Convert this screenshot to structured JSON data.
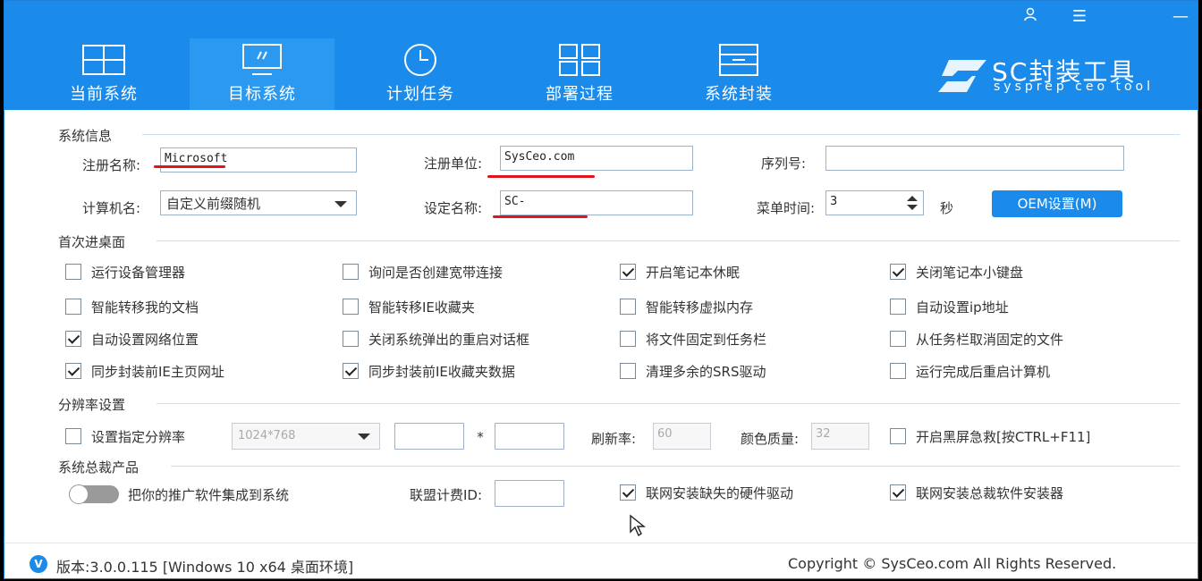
{
  "window": {
    "controls": {
      "user": "user-icon",
      "menu": "☰",
      "close": "—"
    }
  },
  "tabs": [
    {
      "label": "当前系统",
      "icon": "windows-icon"
    },
    {
      "label": "目标系统",
      "icon": "monitor-icon",
      "active": true
    },
    {
      "label": "计划任务",
      "icon": "clock-icon"
    },
    {
      "label": "部署过程",
      "icon": "grid-icon"
    },
    {
      "label": "系统封装",
      "icon": "package-icon"
    }
  ],
  "logo": {
    "title": "SC封装工具",
    "subtitle": "sysprep ceo tool"
  },
  "sys_info": {
    "section": "系统信息",
    "reg_name_label": "注册名称:",
    "reg_name_value": "Microsoft",
    "reg_org_label": "注册单位:",
    "reg_org_value": "SysCeo.com",
    "serial_label": "序列号:",
    "serial_value": "",
    "computer_label": "计算机名:",
    "computer_value": "自定义前缀随机",
    "setname_label": "设定名称:",
    "setname_value": "SC-",
    "menu_time_label": "菜单时间:",
    "menu_time_value": "3",
    "menu_time_unit": "秒",
    "oem_button": "OEM设置(M)"
  },
  "first_desktop": {
    "section": "首次进桌面",
    "options": [
      {
        "label": "运行设备管理器",
        "checked": false
      },
      {
        "label": "询问是否创建宽带连接",
        "checked": false
      },
      {
        "label": "开启笔记本休眠",
        "checked": true
      },
      {
        "label": "关闭笔记本小键盘",
        "checked": true
      },
      {
        "label": "智能转移我的文档",
        "checked": false
      },
      {
        "label": "智能转移IE收藏夹",
        "checked": false
      },
      {
        "label": "智能转移虚拟内存",
        "checked": false
      },
      {
        "label": "自动设置ip地址",
        "checked": false
      },
      {
        "label": "自动设置网络位置",
        "checked": true
      },
      {
        "label": "关闭系统弹出的重启对话框",
        "checked": false
      },
      {
        "label": "将文件固定到任务栏",
        "checked": false
      },
      {
        "label": "从任务栏取消固定的文件",
        "checked": false
      },
      {
        "label": "同步封装前IE主页网址",
        "checked": true
      },
      {
        "label": "同步封装前IE收藏夹数据",
        "checked": true
      },
      {
        "label": "清理多余的SRS驱动",
        "checked": false
      },
      {
        "label": "运行完成后重启计算机",
        "checked": false
      }
    ]
  },
  "resolution": {
    "section": "分辨率设置",
    "set_label": "设置指定分辨率",
    "set_checked": false,
    "preset": "1024*768",
    "width": "",
    "times": "*",
    "height": "",
    "refresh_label": "刷新率:",
    "refresh_value": "60",
    "color_label": "颜色质量:",
    "color_value": "32",
    "blackscreen_label": "开启黑屏急救[按CTRL+F11]",
    "blackscreen_checked": false
  },
  "product": {
    "section": "系统总裁产品",
    "toggle_label": "把你的推广软件集成到系统",
    "toggle_on": false,
    "alliance_label": "联盟计费ID:",
    "alliance_value": "",
    "driver_label": "联网安装缺失的硬件驱动",
    "driver_checked": true,
    "installer_label": "联网安装总裁软件安装器",
    "installer_checked": true
  },
  "footer": {
    "badge": "V",
    "version": "版本:3.0.0.115 [Windows 10 x64 桌面环境]",
    "copyright": "Copyright © SysCeo.com All Rights Reserved."
  },
  "colors": {
    "accent": "#1a8bea",
    "annotation": "#e0141a"
  }
}
